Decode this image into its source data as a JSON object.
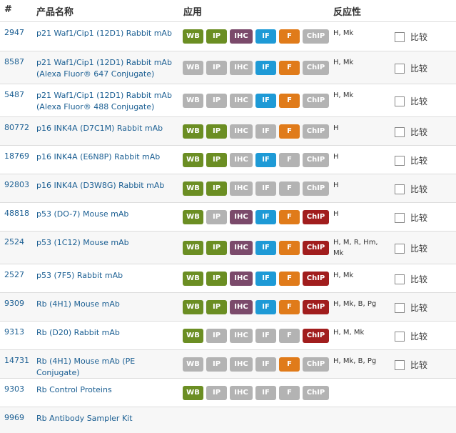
{
  "headers": {
    "num": "#",
    "name": "产品名称",
    "app": "应用",
    "reactivity": "反应性"
  },
  "compare_label": "比较",
  "rows": [
    {
      "cat": "2947",
      "name": "p21 Waf1/Cip1 (12D1) Rabbit mAb",
      "name2": "",
      "reactivity": "H, Mk",
      "apps": [
        "WB",
        "IP",
        "IHC",
        "IF",
        "F",
        "ChIP"
      ],
      "active": [
        1,
        1,
        1,
        1,
        1,
        0
      ],
      "chip_color": "",
      "compare": true
    },
    {
      "cat": "8587",
      "name": "p21 Waf1/Cip1 (12D1) Rabbit mAb",
      "name2": "(Alexa Fluor® 647 Conjugate)",
      "reactivity": "H, Mk",
      "apps": [
        "WB",
        "IP",
        "IHC",
        "IF",
        "F",
        "ChIP"
      ],
      "active": [
        0,
        0,
        0,
        1,
        1,
        0
      ],
      "chip_color": "",
      "compare": true
    },
    {
      "cat": "5487",
      "name": "p21 Waf1/Cip1 (12D1) Rabbit mAb",
      "name2": "(Alexa Fluor® 488 Conjugate)",
      "reactivity": "H, Mk",
      "apps": [
        "WB",
        "IP",
        "IHC",
        "IF",
        "F",
        "ChIP"
      ],
      "active": [
        0,
        0,
        0,
        1,
        1,
        0
      ],
      "chip_color": "",
      "compare": true
    },
    {
      "cat": "80772",
      "name": "p16 INK4A (D7C1M) Rabbit mAb",
      "name2": "",
      "reactivity": "H",
      "apps": [
        "WB",
        "IP",
        "IHC",
        "IF",
        "F",
        "ChIP"
      ],
      "active": [
        1,
        1,
        0,
        0,
        1,
        0
      ],
      "chip_color": "",
      "compare": true
    },
    {
      "cat": "18769",
      "name": "p16 INK4A (E6N8P) Rabbit mAb",
      "name2": "",
      "reactivity": "H",
      "apps": [
        "WB",
        "IP",
        "IHC",
        "IF",
        "F",
        "ChIP"
      ],
      "active": [
        1,
        1,
        0,
        1,
        0,
        0
      ],
      "chip_color": "",
      "compare": true
    },
    {
      "cat": "92803",
      "name": "p16 INK4A (D3W8G) Rabbit mAb",
      "name2": "",
      "reactivity": "H",
      "apps": [
        "WB",
        "IP",
        "IHC",
        "IF",
        "F",
        "ChIP"
      ],
      "active": [
        1,
        1,
        0,
        0,
        0,
        0
      ],
      "chip_color": "",
      "compare": true
    },
    {
      "cat": "48818",
      "name": "p53 (DO-7) Mouse mAb",
      "name2": "",
      "reactivity": "H",
      "apps": [
        "WB",
        "IP",
        "IHC",
        "IF",
        "F",
        "ChIP"
      ],
      "active": [
        1,
        0,
        1,
        1,
        1,
        1
      ],
      "chip_color": "r",
      "compare": true
    },
    {
      "cat": "2524",
      "name": "p53 (1C12) Mouse mAb",
      "name2": "",
      "reactivity": "H, M, R, Hm,",
      "reactivity2": "Mk",
      "apps": [
        "WB",
        "IP",
        "IHC",
        "IF",
        "F",
        "ChIP"
      ],
      "active": [
        1,
        1,
        1,
        1,
        1,
        1
      ],
      "chip_color": "r",
      "compare": true
    },
    {
      "cat": "2527",
      "name": "p53 (7F5) Rabbit mAb",
      "name2": "",
      "reactivity": "H, Mk",
      "apps": [
        "WB",
        "IP",
        "IHC",
        "IF",
        "F",
        "ChIP"
      ],
      "active": [
        1,
        1,
        1,
        1,
        1,
        1
      ],
      "chip_color": "r",
      "compare": true
    },
    {
      "cat": "9309",
      "name": "Rb (4H1) Mouse mAb",
      "name2": "",
      "reactivity": "H, Mk, B, Pg",
      "apps": [
        "WB",
        "IP",
        "IHC",
        "IF",
        "F",
        "ChIP"
      ],
      "active": [
        1,
        1,
        1,
        1,
        1,
        1
      ],
      "chip_color": "r",
      "compare": true
    },
    {
      "cat": "9313",
      "name": "Rb (D20) Rabbit mAb",
      "name2": "",
      "reactivity": "H, M, Mk",
      "apps": [
        "WB",
        "IP",
        "IHC",
        "IF",
        "F",
        "ChIP"
      ],
      "active": [
        1,
        0,
        0,
        0,
        0,
        1
      ],
      "chip_color": "r",
      "compare": true
    },
    {
      "cat": "14731",
      "name": "Rb (4H1) Mouse mAb (PE Conjugate)",
      "name2": "",
      "reactivity": "H, Mk, B, Pg",
      "apps": [
        "WB",
        "IP",
        "IHC",
        "IF",
        "F",
        "ChIP"
      ],
      "active": [
        0,
        0,
        0,
        0,
        1,
        0
      ],
      "chip_color": "",
      "compare": true
    },
    {
      "cat": "9303",
      "name": "Rb Control Proteins",
      "name2": "",
      "reactivity": "",
      "apps": [
        "WB",
        "IP",
        "IHC",
        "IF",
        "F",
        "ChIP"
      ],
      "active": [
        1,
        0,
        0,
        0,
        0,
        0
      ],
      "chip_color": "",
      "compare": false
    },
    {
      "cat": "9969",
      "name": "Rb Antibody Sampler Kit",
      "name2": "",
      "reactivity": "",
      "apps": [],
      "active": [],
      "chip_color": "",
      "compare": false
    }
  ]
}
